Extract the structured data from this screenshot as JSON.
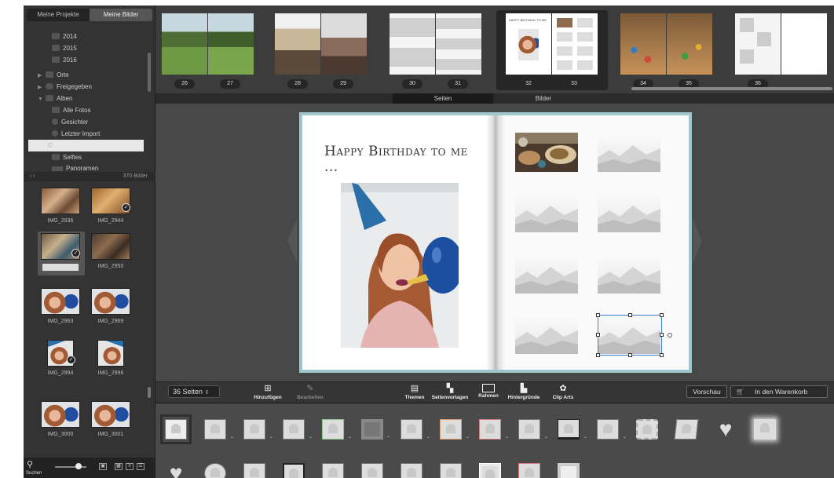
{
  "sidebar": {
    "tabs": [
      "Meine Projekte",
      "Meine Bilder"
    ],
    "tree": {
      "years": [
        "2014",
        "2015",
        "2016"
      ],
      "places": "Orte",
      "shared": "Freigegeben",
      "albums": "Alben",
      "all_photos": "Alle Fotos",
      "faces": "Gesichter",
      "last_import": "Letzter Import",
      "favorites_icon": "♡",
      "selfies": "Selfies",
      "panoramas": "Panoramen"
    },
    "grid_nav": "‹  ›",
    "photo_count": "370 Bilder",
    "photos": [
      {
        "name": "IMG_2936"
      },
      {
        "name": "IMG_2944"
      },
      {
        "name": "IMG_2948"
      },
      {
        "name": "IMG_2950"
      },
      {
        "name": "IMG_2963"
      },
      {
        "name": "IMG_2969"
      },
      {
        "name": "IMG_2994"
      },
      {
        "name": "IMG_2996"
      },
      {
        "name": "IMG_3000"
      },
      {
        "name": "IMG_3001"
      }
    ],
    "search_label": "Suchen"
  },
  "strip": {
    "page_numbers": [
      "26",
      "27",
      "28",
      "29",
      "30",
      "31",
      "32",
      "33",
      "34",
      "35",
      "36"
    ]
  },
  "view_tabs": [
    "Seiten",
    "Bilder"
  ],
  "book": {
    "headline": "Happy Birthday to me ...",
    "mini_headline": "HAPPY BIRTHDAY TO ME"
  },
  "toolbar": {
    "pages_select": "36 Seiten",
    "add": "Hinzufügen",
    "edit": "Bearbeiten",
    "themes": "Themen",
    "layouts": "Seitenvorlagen",
    "frames": "Rahmen",
    "backgrounds": "Hintergründe",
    "clip_arts": "Clip Arts",
    "preview": "Vorschau",
    "cart": "In den Warenkorb"
  },
  "colors": {
    "accent": "#3b7fd6",
    "book_edge": "#9ec7cc"
  }
}
